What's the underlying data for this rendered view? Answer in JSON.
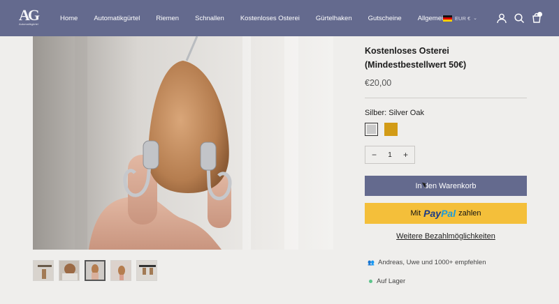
{
  "header": {
    "logo_mark": "AG",
    "logo_sub": "Automatikgürtel",
    "nav": [
      "Home",
      "Automatikgürtel",
      "Riemen",
      "Schnallen",
      "Kostenloses Osterei",
      "Gürtelhaken",
      "Gutscheine",
      "Allgemein"
    ],
    "currency": "EUR €",
    "icons": [
      "germany-flag-icon",
      "account-icon",
      "search-icon",
      "cart-icon"
    ],
    "brand_color": "#646a8e"
  },
  "product": {
    "title": "Kostenloses Osterei (Mindestbestellwert 50€)",
    "price": "€20,00",
    "variant_label": "Silber: Silver Oak",
    "swatch_colors": [
      "#c9c9c9",
      "#d29b16"
    ],
    "quantity": "1",
    "qty_minus": "−",
    "qty_plus": "+",
    "add_to_cart": "In den Warenkorb",
    "paypal_prefix": "Mit",
    "paypal_logo_1": "Pay",
    "paypal_logo_2": "Pal",
    "paypal_suffix": "zahlen",
    "more_payment": "Weitere Bezahlmöglichkeiten",
    "recommend": "Andreas, Uwe und 1000+ empfehlen",
    "stock": "Auf Lager",
    "paypal_color": "#f4bf3a"
  },
  "gallery": {
    "thumb_count": 5,
    "active_thumb": 3
  }
}
